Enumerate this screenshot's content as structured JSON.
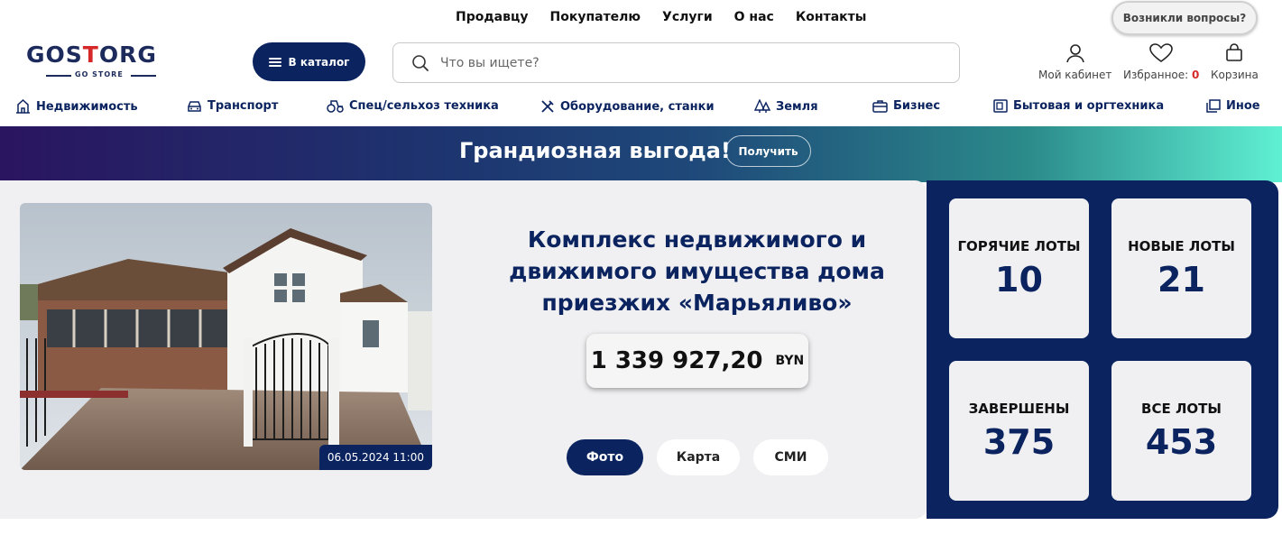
{
  "topnav": [
    "Продавцу",
    "Покупателю",
    "Услуги",
    "О нас",
    "Контакты"
  ],
  "help_button": "Возникли вопросы?",
  "logo": {
    "main_a": "GOS",
    "main_b": "T",
    "main_c": "ORG",
    "sub": "GO STORE"
  },
  "catalog_button": "В каталог",
  "search": {
    "placeholder": "Что вы ищете?"
  },
  "user": {
    "cabinet": "Мой кабинет",
    "favorites": "Избранное:",
    "favorites_count": "0",
    "cart": "Корзина"
  },
  "categories": [
    "Недвижимость",
    "Транспорт",
    "Спец/сельхоз техника",
    "Оборудование, станки",
    "Земля",
    "Бизнес",
    "Бытовая и оргтехника",
    "Иное"
  ],
  "banner": {
    "title": "Грандиозная выгода!",
    "button": "Получить"
  },
  "lot": {
    "title": "Комплекс недвижимого и движимого имущества дома приезжих «Марьяливо»",
    "price": "1 339 927,20",
    "currency": "BYN",
    "date": "06.05.2024 11:00",
    "tabs": [
      "Фото",
      "Карта",
      "СМИ"
    ]
  },
  "stats": [
    {
      "label": "Горячие лоты",
      "value": "10"
    },
    {
      "label": "Новые лоты",
      "value": "21"
    },
    {
      "label": "Завершены",
      "value": "375"
    },
    {
      "label": "Все лоты",
      "value": "453"
    }
  ],
  "colors": {
    "navy": "#0b2460",
    "red": "#d62828"
  }
}
